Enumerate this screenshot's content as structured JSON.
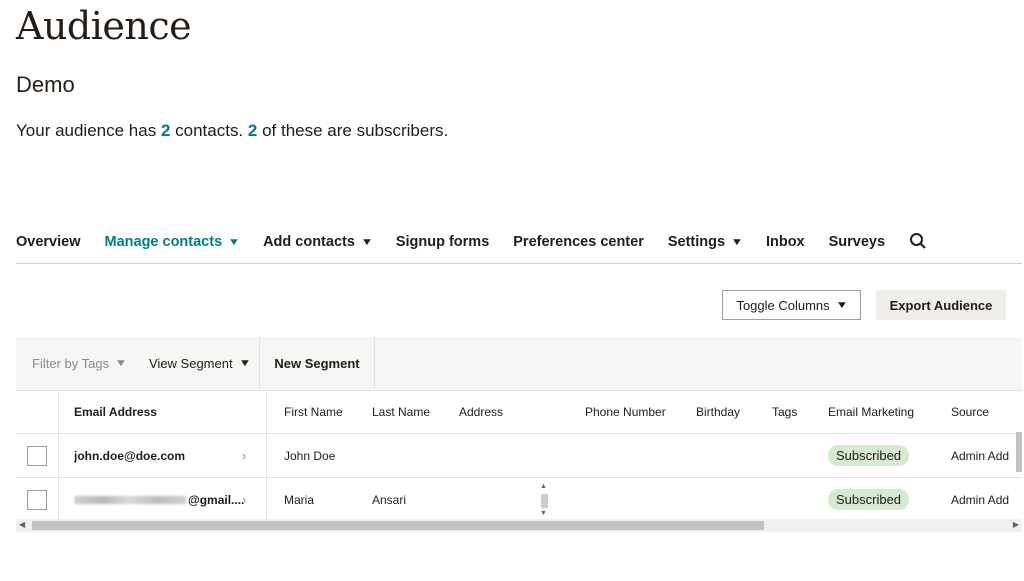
{
  "header": {
    "title": "Audience",
    "audience_name": "Demo",
    "summary": {
      "prefix": "Your audience has ",
      "contacts": "2",
      "middle": " contacts. ",
      "subscribers": "2",
      "suffix": " of these are subscribers."
    }
  },
  "nav": {
    "items": [
      {
        "label": "Overview",
        "active": false,
        "dropdown": false
      },
      {
        "label": "Manage contacts",
        "active": true,
        "dropdown": true
      },
      {
        "label": "Add contacts",
        "active": false,
        "dropdown": true
      },
      {
        "label": "Signup forms",
        "active": false,
        "dropdown": false
      },
      {
        "label": "Preferences center",
        "active": false,
        "dropdown": false
      },
      {
        "label": "Settings",
        "active": false,
        "dropdown": true
      },
      {
        "label": "Inbox",
        "active": false,
        "dropdown": false
      },
      {
        "label": "Surveys",
        "active": false,
        "dropdown": false
      }
    ],
    "search_icon": "search-icon"
  },
  "actions": {
    "toggle_columns": "Toggle Columns",
    "export_audience": "Export Audience"
  },
  "filters": {
    "filter_by_tags": "Filter by Tags",
    "view_segment": "View Segment",
    "new_segment": "New Segment"
  },
  "table": {
    "columns": {
      "email": "Email Address",
      "first_name": "First Name",
      "last_name": "Last Name",
      "address": "Address",
      "phone": "Phone Number",
      "birthday": "Birthday",
      "tags": "Tags",
      "email_marketing": "Email Marketing",
      "source": "Source"
    },
    "rows": [
      {
        "email": "john.doe@doe.com",
        "first_name": "John Doe",
        "last_name": "",
        "address": "",
        "phone": "",
        "birthday": "",
        "tags": "",
        "email_marketing": "Subscribed",
        "source": "Admin Add"
      },
      {
        "email": "@gmail....",
        "first_name": "Maria",
        "last_name": "Ansari",
        "address": "",
        "phone": "",
        "birthday": "",
        "tags": "",
        "email_marketing": "Subscribed",
        "source": "Admin Add"
      }
    ]
  },
  "colors": {
    "accent": "#007c89",
    "subscribed_badge": "#d5ebd1",
    "text": "#241c15"
  }
}
